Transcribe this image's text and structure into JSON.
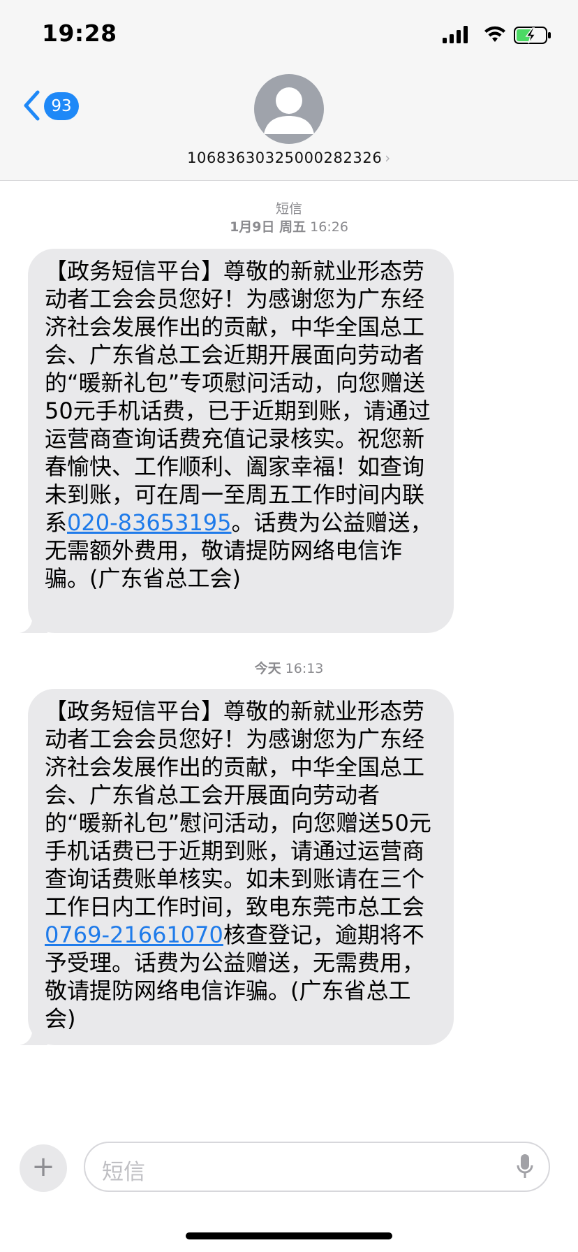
{
  "status_bar": {
    "time": "19:28"
  },
  "header": {
    "back_badge": "93",
    "contact_number": "106836303250002823​26",
    "contact_chevron": "›"
  },
  "thread": {
    "service_label": "短信",
    "date_1_day": "1月9日 周五",
    "date_1_time": "16:26",
    "msg1": {
      "text_before_link": "【政务短信平台】尊敬的新就业形态劳动者工会会员您好！为感谢您为广东经济社会发展作出的贡献，中华全国总工会、广东省总工会近期开展面向劳动者的“暖新礼包”专项慰问活动，向您赠送50元手机话费，已于近期到账，请通过运营商查询话费充值记录核实。祝您新春愉快、工作顺利、阖家幸福！如查询未到账，可在周一至周五工作时间内联系",
      "link": "020-83653195",
      "text_after_link": "。话费为公益赠送，无需额外费用，敬请提防网络电信诈骗。(广东省总工会)"
    },
    "date_2_day": "今天",
    "date_2_time": "16:13",
    "msg2": {
      "text_before_link": "【政务短信平台】尊敬的新就业形态劳动者工会会员您好！为感谢您为广东经济社会发展作出的贡献，中华全国总工会、广东省总工会开展面向劳动者的“暖新礼包”慰问活动，向您赠送50元手机话费已于近期到账，请通过运营商查询话费账单核实。如未到账请在三个工作日内工作时间，致电东莞市总工会",
      "link": "0769-21661070",
      "text_after_link": "核查登记，逾期将不予受理。话费为公益赠送，无需费用，敬请提防网络电信诈骗。(广东省总工会)"
    }
  },
  "composer": {
    "plus_label": "+",
    "placeholder": "短信"
  },
  "icons": {
    "back": "chevron-left-icon",
    "avatar": "person-icon",
    "mic": "microphone-icon",
    "signal": "signal-icon",
    "wifi": "wifi-icon",
    "battery": "battery-charging-icon"
  },
  "colors": {
    "accent": "#1e88f7",
    "bubble_received": "#e9e9eb",
    "link": "#1f7bea",
    "battery_fill": "#4cd964"
  }
}
